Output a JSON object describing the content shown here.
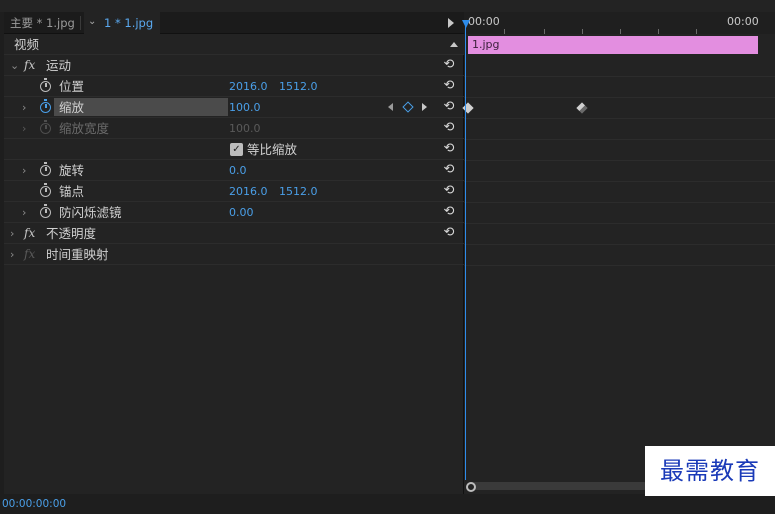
{
  "tabs": {
    "main_label": "主要 * 1.jpg",
    "clip_label": "1 * 1.jpg"
  },
  "section": {
    "title": "视频"
  },
  "effects": {
    "motion": {
      "label": "运动",
      "position": {
        "label": "位置",
        "x": "2016.0",
        "y": "1512.0"
      },
      "scale": {
        "label": "缩放",
        "value": "100.0"
      },
      "scale_width": {
        "label": "缩放宽度",
        "value": "100.0"
      },
      "uniform_scale": {
        "label": "等比缩放",
        "checked": true
      },
      "rotation": {
        "label": "旋转",
        "value": "0.0"
      },
      "anchor": {
        "label": "锚点",
        "x": "2016.0",
        "y": "1512.0"
      },
      "flicker": {
        "label": "防闪烁滤镜",
        "value": "0.00"
      }
    },
    "opacity": {
      "label": "不透明度"
    },
    "time_remap": {
      "label": "时间重映射"
    }
  },
  "timeline": {
    "ruler_start": "00:00",
    "ruler_end": "00:00",
    "clip_name": "1.jpg",
    "clip_color": "#e38ee0"
  },
  "footer": {
    "timecode": "00:00:00:00"
  },
  "watermark": {
    "text": "最需教育"
  },
  "icons": {
    "stopwatch": "stopwatch-icon",
    "reset": "reset-icon",
    "chevron": "chevron-right-icon"
  }
}
